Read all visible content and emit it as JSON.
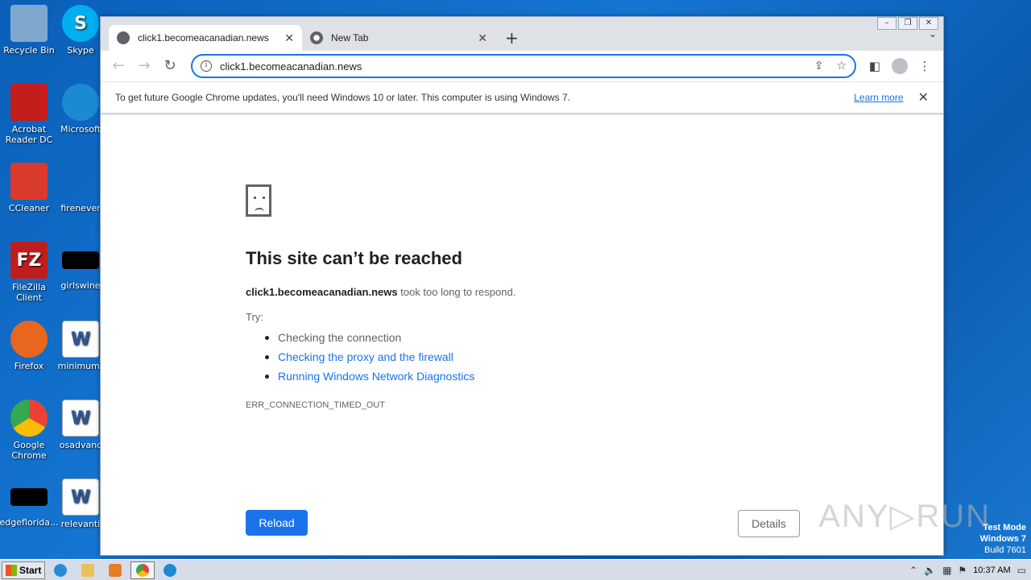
{
  "desktop": {
    "icons_col1": [
      {
        "label": "Recycle Bin",
        "icon": "recycle-bin-icon",
        "color": "#7fa8cf"
      },
      {
        "label": "Acrobat Reader DC",
        "icon": "acrobat-icon",
        "color": "#c51c1c"
      },
      {
        "label": "CCleaner",
        "icon": "ccleaner-icon",
        "color": "#d93a2b"
      },
      {
        "label": "FileZilla Client",
        "icon": "filezilla-icon",
        "color": "#bf1e1e"
      },
      {
        "label": "Firefox",
        "icon": "firefox-icon",
        "color": "#e8661e"
      },
      {
        "label": "Google Chrome",
        "icon": "chrome-icon",
        "color": "#34a853"
      },
      {
        "label": "edgeflorida...",
        "icon": "blank-icon",
        "color": "#000000"
      }
    ],
    "icons_col2": [
      {
        "label": "Skype",
        "icon": "skype-icon",
        "color": "#00aff0"
      },
      {
        "label": "Microsoft",
        "icon": "edge-icon",
        "color": "#1b8ad3"
      },
      {
        "label": "firenever",
        "icon": "blank-icon",
        "color": "#1476d2"
      },
      {
        "label": "girlswine",
        "icon": "blank-icon",
        "color": "#000000"
      },
      {
        "label": "minimumr",
        "icon": "word-doc-icon",
        "color": "#ffffff"
      },
      {
        "label": "osadvanc",
        "icon": "word-doc-icon",
        "color": "#ffffff"
      },
      {
        "label": "relevanti",
        "icon": "word-doc-icon",
        "color": "#ffffff"
      }
    ]
  },
  "browser": {
    "tabs": [
      {
        "title": "click1.becomeacanadian.news",
        "active": true
      },
      {
        "title": "New Tab",
        "active": false
      }
    ],
    "url": "click1.becomeacanadian.news",
    "infobar": {
      "message": "To get future Google Chrome updates, you'll need Windows 10 or later. This computer is using Windows 7.",
      "link": "Learn more"
    }
  },
  "error_page": {
    "title": "This site can’t be reached",
    "host": "click1.becomeacanadian.news",
    "desc_suffix": " took too long to respond.",
    "try_label": "Try:",
    "suggestions": [
      {
        "text": "Checking the connection",
        "link": false
      },
      {
        "text": "Checking the proxy and the firewall",
        "link": true
      },
      {
        "text": "Running Windows Network Diagnostics",
        "link": true
      }
    ],
    "error_code": "ERR_CONNECTION_TIMED_OUT",
    "reload_label": "Reload",
    "details_label": "Details"
  },
  "watermark": {
    "text": "ANY▷RUN",
    "test_mode": "Test Mode",
    "os": "Windows 7",
    "build": "Build 7601"
  },
  "taskbar": {
    "start_label": "Start",
    "clock": "10:37 AM"
  },
  "colors": {
    "accent": "#1a73e8",
    "desktop": "#1476d2"
  }
}
